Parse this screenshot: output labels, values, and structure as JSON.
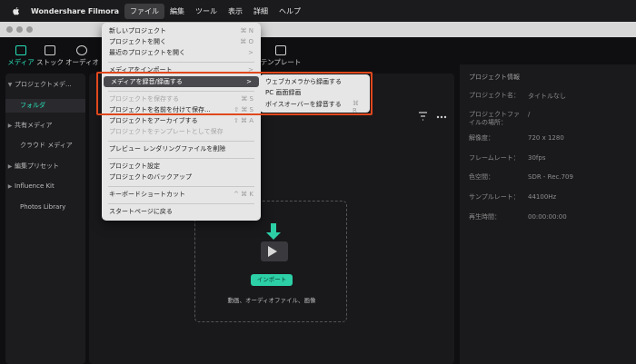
{
  "menubar": {
    "app_name": "Wondershare Filmora",
    "items": [
      "ファイル",
      "編集",
      "ツール",
      "表示",
      "詳細",
      "ヘルプ"
    ]
  },
  "toolbar": {
    "items": [
      "メディア",
      "ストック",
      "オーディオ",
      "テンプレート"
    ]
  },
  "sidebar": {
    "items": [
      {
        "label": "プロジェクトメデ..."
      },
      {
        "label": "フォルダ"
      },
      {
        "label": "共有メディア"
      },
      {
        "label": "クラウド メディア"
      },
      {
        "label": "編集プリセット"
      },
      {
        "label": "Influence Kit"
      },
      {
        "label": "Photos Library"
      }
    ]
  },
  "file_menu": {
    "items": [
      {
        "label": "新しいプロジェクト",
        "shortcut": "⌘ N"
      },
      {
        "label": "プロジェクトを開く",
        "shortcut": "⌘ O"
      },
      {
        "label": "最近のプロジェクトを開く",
        "shortcut": ">"
      },
      {
        "label": "メディアをインポート",
        "shortcut": ">"
      },
      {
        "label": "メディアを録音/録画する",
        "shortcut": ">"
      },
      {
        "label": "プロジェクトを保存する",
        "shortcut": "⌘ S"
      },
      {
        "label": "プロジェクトを名前を付けて保存...",
        "shortcut": "⇧ ⌘ S"
      },
      {
        "label": "プロジェクトをアーカイブする",
        "shortcut": "⇧ ⌘ A"
      },
      {
        "label": "プロジェクトをテンプレートとして保存",
        "shortcut": ""
      },
      {
        "label": "プレビュー レンダリングファイルを削除",
        "shortcut": ""
      },
      {
        "label": "プロジェクト設定",
        "shortcut": ""
      },
      {
        "label": "プロジェクトのバックアップ",
        "shortcut": ""
      },
      {
        "label": "キーボードショートカット",
        "shortcut": "^ ⌘ K"
      },
      {
        "label": "スタートページに戻る",
        "shortcut": ""
      }
    ]
  },
  "submenu": {
    "items": [
      {
        "label": "ウェブカメラから録画する",
        "shortcut": ""
      },
      {
        "label": "PC 画面録画",
        "shortcut": ""
      },
      {
        "label": "ボイスオーバーを録音する",
        "shortcut": "⌘ R"
      }
    ]
  },
  "dropzone": {
    "import_label": "インポート",
    "hint": "動画、オーディオファイル、画像"
  },
  "project_info": {
    "title": "プロジェクト情報",
    "rows": [
      {
        "label": "プロジェクト名：",
        "value": "タイトルなし"
      },
      {
        "label": "プロジェクトファイルの場所：",
        "value": "/"
      },
      {
        "label": "解像度：",
        "value": "720 x 1280"
      },
      {
        "label": "フレームレート：",
        "value": "30fps"
      },
      {
        "label": "色空間：",
        "value": "SDR - Rec.709"
      },
      {
        "label": "サンプルレート：",
        "value": "44100Hz"
      },
      {
        "label": "再生時間：",
        "value": "00:00:00:00"
      }
    ]
  },
  "colors": {
    "accent": "#28e0b9",
    "highlight_border": "#e0481d"
  }
}
